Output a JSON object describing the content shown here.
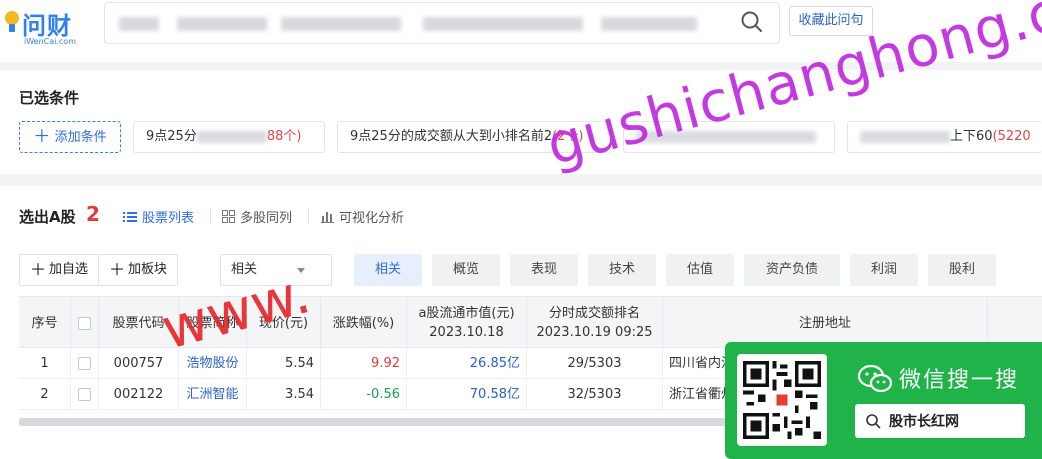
{
  "header": {
    "logo_text": "问财",
    "logo_sub": "iWenCai.com",
    "collect_label": "收藏此问句"
  },
  "conditions": {
    "title": "已选条件",
    "add_label": "添加条件",
    "chips": [
      {
        "text": "9点25分",
        "count": "88个)"
      },
      {
        "text": "9点25分的成交额从大到小排名前2",
        "count": "(2个)"
      },
      {
        "text": "",
        "count": ""
      },
      {
        "text": "上下60",
        "count": "(5220"
      }
    ]
  },
  "results": {
    "title": "选出A股",
    "count": "2",
    "views": [
      "股票列表",
      "多股同列",
      "可视化分析"
    ],
    "add_watch": "加自选",
    "add_block": "加板块",
    "sort_value": "相关",
    "filter_tabs": [
      "相关",
      "概览",
      "表现",
      "技术",
      "估值",
      "资产负债",
      "利润",
      "股利"
    ]
  },
  "table": {
    "headers": [
      {
        "l1": "序号",
        "l2": ""
      },
      {
        "l1": "",
        "l2": ""
      },
      {
        "l1": "股票代码",
        "l2": ""
      },
      {
        "l1": "股票简称",
        "l2": ""
      },
      {
        "l1": "现价(元)",
        "l2": ""
      },
      {
        "l1": "涨跌幅(%)",
        "l2": ""
      },
      {
        "l1": "a股流通市值(元)",
        "l2": "2023.10.18"
      },
      {
        "l1": "分时成交额排名",
        "l2": "2023.10.19 09:25"
      },
      {
        "l1": "注册地址",
        "l2": ""
      }
    ],
    "rows": [
      {
        "idx": "1",
        "code": "000757",
        "name": "浩物股份",
        "price": "5.54",
        "change": "9.92",
        "mcap": "26.85亿",
        "rank": "29/5303",
        "addr": "四川省内江"
      },
      {
        "idx": "2",
        "code": "002122",
        "name": "汇洲智能",
        "price": "3.54",
        "change": "-0.56",
        "mcap": "70.58亿",
        "rank": "32/5303",
        "addr": "浙江省衢州"
      }
    ]
  },
  "watermark": {
    "top": "gushichanghong.com",
    "bottom": "www."
  },
  "wechat": {
    "title": "微信搜一搜",
    "search_text": "股市长红网"
  },
  "colors": {
    "accent": "#2f6de0",
    "up": "#e03a3a",
    "down": "#1f9a4e",
    "wechat_green": "#1fb349"
  }
}
